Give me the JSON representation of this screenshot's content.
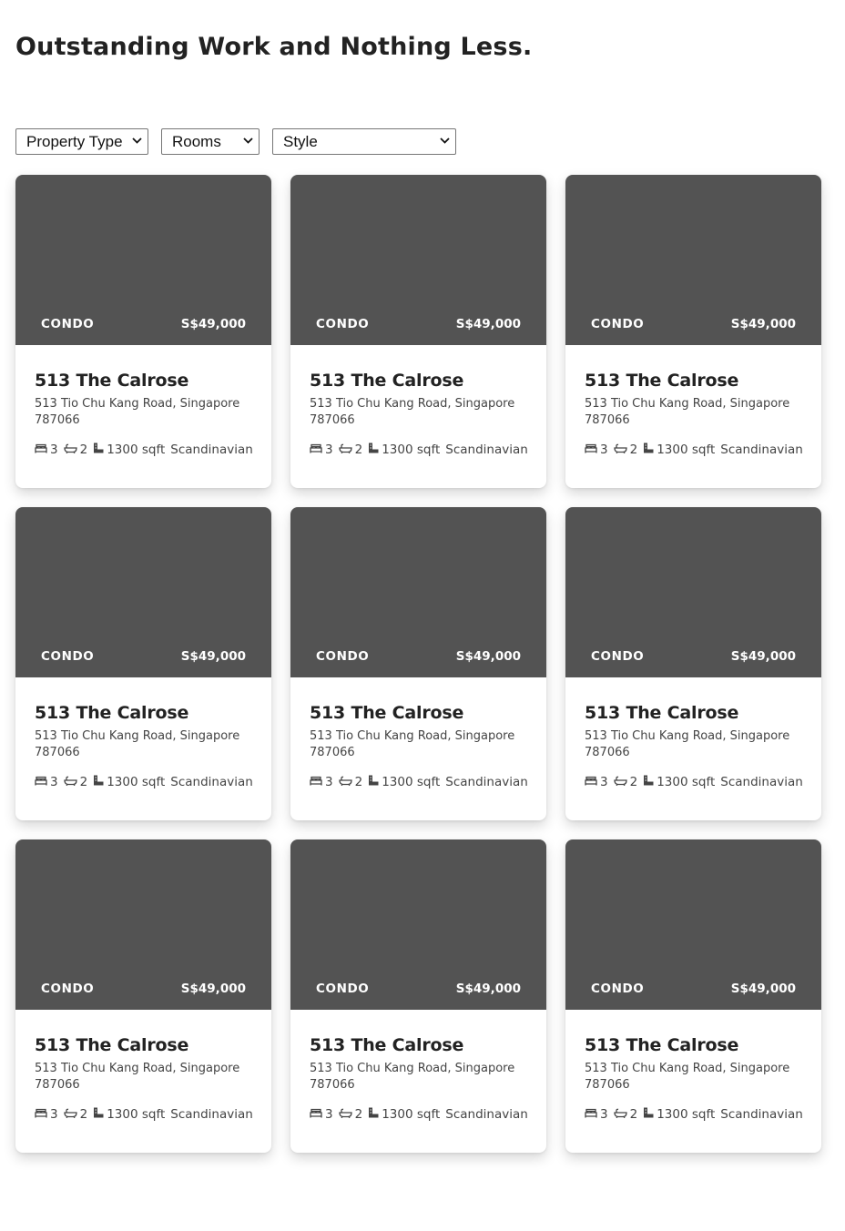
{
  "page": {
    "title": "Outstanding Work and Nothing Less."
  },
  "filters": {
    "property_type": "Property Type",
    "rooms": "Rooms",
    "style": "Style"
  },
  "colors": {
    "image_placeholder": "#535353",
    "text_dark": "#222222"
  },
  "listings": [
    {
      "type": "CONDO",
      "price": "S$49,000",
      "name": "513 The Calrose",
      "address": "513 Tio Chu Kang Road, Singapore 787066",
      "bedrooms": "3",
      "bathrooms": "2",
      "area": "1300 sqft",
      "style": "Scandinavian"
    },
    {
      "type": "CONDO",
      "price": "S$49,000",
      "name": "513 The Calrose",
      "address": "513 Tio Chu Kang Road, Singapore 787066",
      "bedrooms": "3",
      "bathrooms": "2",
      "area": "1300 sqft",
      "style": "Scandinavian"
    },
    {
      "type": "CONDO",
      "price": "S$49,000",
      "name": "513 The Calrose",
      "address": "513 Tio Chu Kang Road, Singapore 787066",
      "bedrooms": "3",
      "bathrooms": "2",
      "area": "1300 sqft",
      "style": "Scandinavian"
    },
    {
      "type": "CONDO",
      "price": "S$49,000",
      "name": "513 The Calrose",
      "address": "513 Tio Chu Kang Road, Singapore 787066",
      "bedrooms": "3",
      "bathrooms": "2",
      "area": "1300 sqft",
      "style": "Scandinavian"
    },
    {
      "type": "CONDO",
      "price": "S$49,000",
      "name": "513 The Calrose",
      "address": "513 Tio Chu Kang Road, Singapore 787066",
      "bedrooms": "3",
      "bathrooms": "2",
      "area": "1300 sqft",
      "style": "Scandinavian"
    },
    {
      "type": "CONDO",
      "price": "S$49,000",
      "name": "513 The Calrose",
      "address": "513 Tio Chu Kang Road, Singapore 787066",
      "bedrooms": "3",
      "bathrooms": "2",
      "area": "1300 sqft",
      "style": "Scandinavian"
    },
    {
      "type": "CONDO",
      "price": "S$49,000",
      "name": "513 The Calrose",
      "address": "513 Tio Chu Kang Road, Singapore 787066",
      "bedrooms": "3",
      "bathrooms": "2",
      "area": "1300 sqft",
      "style": "Scandinavian"
    },
    {
      "type": "CONDO",
      "price": "S$49,000",
      "name": "513 The Calrose",
      "address": "513 Tio Chu Kang Road, Singapore 787066",
      "bedrooms": "3",
      "bathrooms": "2",
      "area": "1300 sqft",
      "style": "Scandinavian"
    },
    {
      "type": "CONDO",
      "price": "S$49,000",
      "name": "513 The Calrose",
      "address": "513 Tio Chu Kang Road, Singapore 787066",
      "bedrooms": "3",
      "bathrooms": "2",
      "area": "1300 sqft",
      "style": "Scandinavian"
    }
  ]
}
